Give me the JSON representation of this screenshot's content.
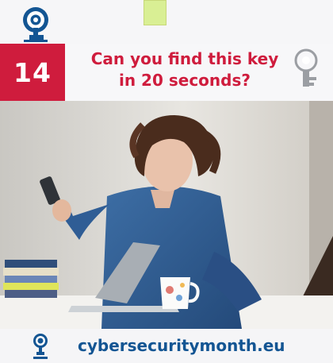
{
  "header": {
    "logo_icon": "cyber-key-logo-icon",
    "number": "14",
    "headline_line1": "Can you find this key",
    "headline_line2": "in 20 seconds?",
    "key_icon": "key-icon"
  },
  "photo": {
    "description_icon": "person-with-phone-and-laptop-photo"
  },
  "footer": {
    "logo_icon": "cyber-key-logo-icon",
    "url": "cybersecuritymonth.eu"
  },
  "colors": {
    "accent_red": "#cf1c3d",
    "brand_blue": "#135593"
  }
}
